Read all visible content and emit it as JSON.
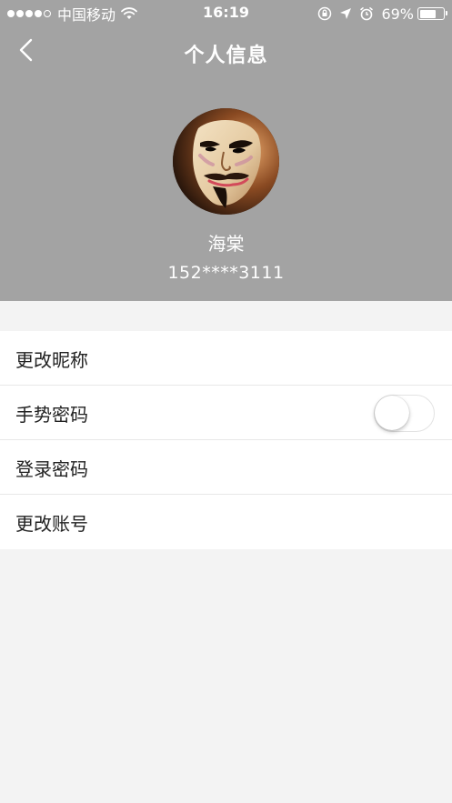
{
  "status_bar": {
    "carrier": "中国移动",
    "time": "16:19",
    "battery_percent": "69%",
    "battery_level": 0.69
  },
  "nav": {
    "title": "个人信息"
  },
  "profile": {
    "nickname": "海棠",
    "phone": "152****3111"
  },
  "settings": {
    "change_nickname": "更改昵称",
    "gesture_password": "手势密码",
    "gesture_password_enabled": false,
    "login_password": "登录密码",
    "change_account": "更改账号"
  },
  "colors": {
    "header_bg": "#a3a3a3",
    "page_bg": "#f3f3f3",
    "list_bg": "#ffffff"
  }
}
